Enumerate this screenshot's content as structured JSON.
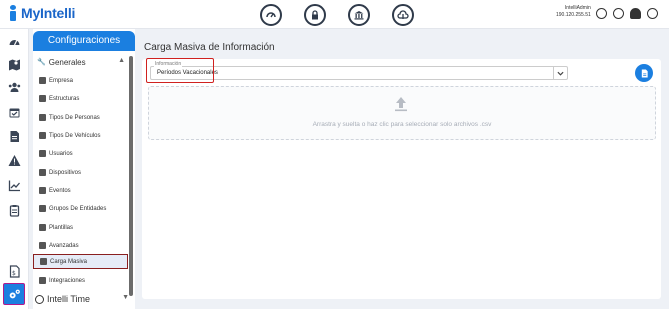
{
  "app": {
    "logo_text": "MyIntelli",
    "user_name": "IntelliAdmin",
    "user_ip": "190.120.255.51"
  },
  "colors": {
    "brand": "#1b7fe0",
    "highlight_red": "#d0211f",
    "rail_active_border": "#b01a8c"
  },
  "top_icons": [
    "dashboard-icon",
    "lock-icon",
    "building-icon",
    "cloud-icon"
  ],
  "rail": {
    "icons": [
      "speedometer-icon",
      "map-icon",
      "people-icon",
      "calendar-check-icon",
      "document-icon",
      "warning-icon",
      "chart-icon",
      "clipboard-icon",
      "report-icon"
    ],
    "active_icon": "gears-icon"
  },
  "sidebar": {
    "title": "Configuraciones",
    "section": "Generales",
    "items": [
      {
        "label": "Empresa",
        "icon": "building-icon"
      },
      {
        "label": "Estructuras",
        "icon": "sitemap-icon"
      },
      {
        "label": "Tipos De Personas",
        "icon": "people-icon"
      },
      {
        "label": "Tipos De Vehículos",
        "icon": "car-icon"
      },
      {
        "label": "Usuarios",
        "icon": "users-icon"
      },
      {
        "label": "Dispositivos",
        "icon": "device-icon"
      },
      {
        "label": "Eventos",
        "icon": "events-icon"
      },
      {
        "label": "Grupos De Entidades",
        "icon": "group-icon"
      },
      {
        "label": "Plantillas",
        "icon": "template-icon"
      },
      {
        "label": "Avanzadas",
        "icon": "advanced-icon"
      },
      {
        "label": "Carga Masiva",
        "icon": "file-upload-icon"
      },
      {
        "label": "Integraciones",
        "icon": "integration-icon"
      }
    ],
    "active_index": 10,
    "bottom_section": "Intelli Time"
  },
  "main": {
    "title": "Carga Masiva de Información",
    "field_label": "Información",
    "field_value": "Períodos Vacacionales",
    "dropzone_text": "Arrastra y suelta o haz clic para seleccionar solo archivos .csv"
  }
}
